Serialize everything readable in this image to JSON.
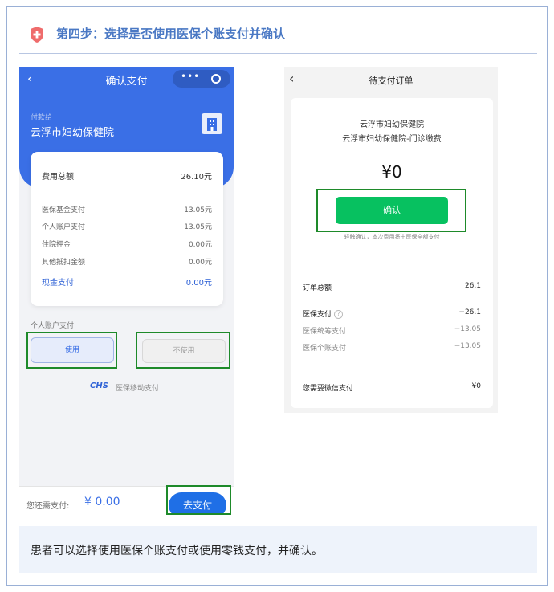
{
  "step_title": "第四步：选择是否使用医保个账支付并确认",
  "left_phone": {
    "nav_title": "确认支付",
    "capsule_dots": "•••",
    "pay_to_label": "付款给",
    "hospital": "云浮市妇幼保健院",
    "rows": [
      {
        "label": "费用总额",
        "value": "26.10元"
      },
      {
        "label": "医保基金支付",
        "value": "13.05元"
      },
      {
        "label": "个人账户支付",
        "value": "13.05元"
      },
      {
        "label": "住院押金",
        "value": "0.00元"
      },
      {
        "label": "其他抵扣金额",
        "value": "0.00元"
      },
      {
        "label": "现金支付",
        "value": "0.00元"
      }
    ],
    "section_label": "个人账户支付",
    "use_label": "使用",
    "no_use_label": "不使用",
    "chs_logo": "CHS",
    "chs_text": "医保移动支付",
    "need_pay_label": "您还需支付:",
    "need_pay_amount": "¥ 0.00",
    "go_pay_label": "去支付"
  },
  "right_phone": {
    "nav_title": "待支付订单",
    "hospital": "云浮市妇幼保健院",
    "dept": "云浮市妇幼保健院-门诊缴费",
    "amount": "¥0",
    "confirm_label": "确认",
    "hint": "轻触确认，本次费用将由医保全额支付",
    "rows": [
      {
        "label": "订单总额",
        "value": "26.1"
      },
      {
        "label": "医保支付",
        "value": "−26.1"
      },
      {
        "label": "医保统筹支付",
        "value": "−13.05"
      },
      {
        "label": "医保个账支付",
        "value": "−13.05"
      },
      {
        "label": "您需要微信支付",
        "value": "¥0"
      }
    ]
  },
  "note": "患者可以选择使用医保个账支付或使用零钱支付，并确认。",
  "colors": {
    "primary_blue": "#3a6fe6",
    "wechat_green": "#07c160",
    "highlight_green": "#1e8a2a",
    "title_blue": "#4a78c4",
    "badge_red": "#ef6c6c"
  }
}
